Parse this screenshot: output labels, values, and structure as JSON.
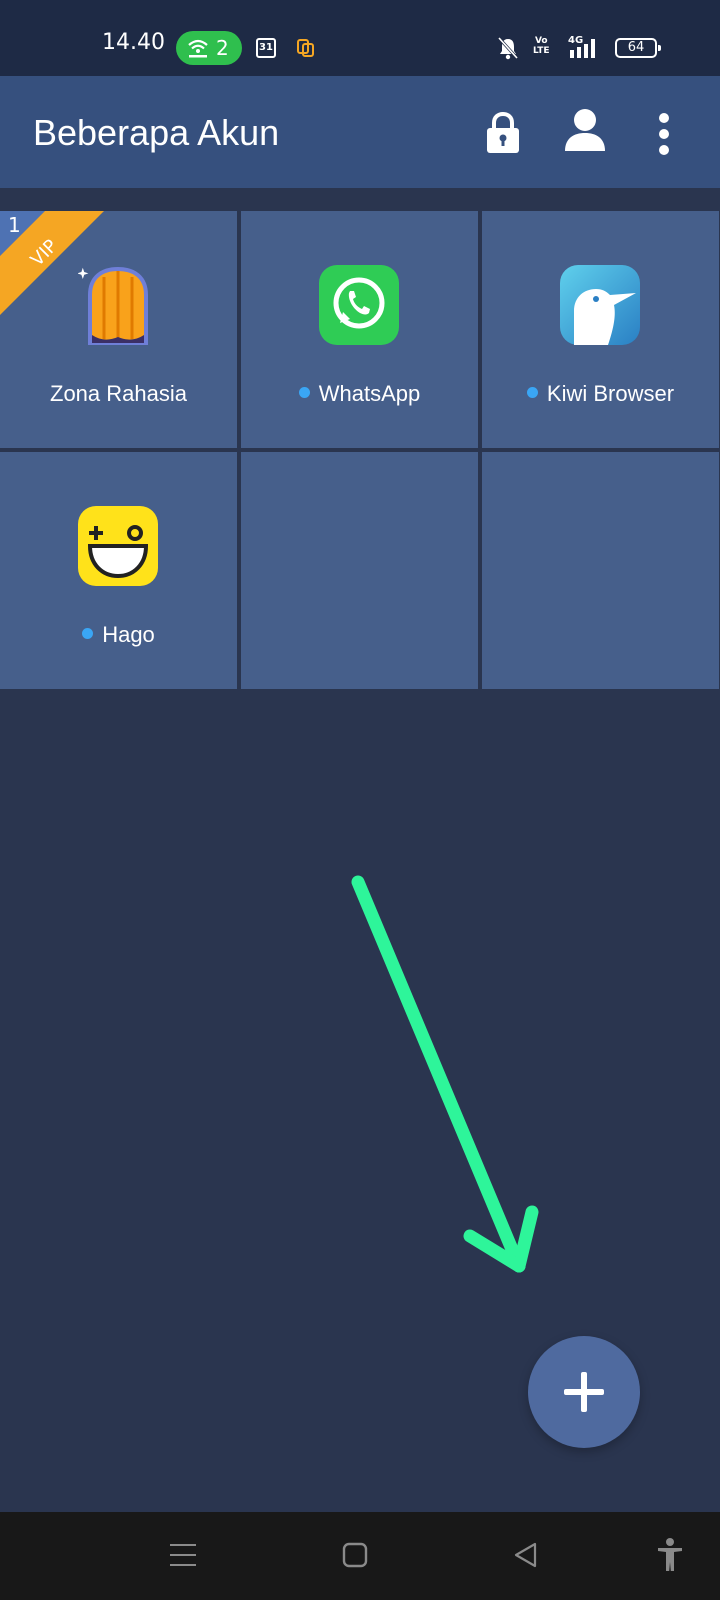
{
  "status_bar": {
    "time": "14.40",
    "hotspot_count": "2",
    "calendar_day": "31",
    "volte_line1": "Vo",
    "volte_line2": "LTE",
    "network": "4G",
    "battery": "64"
  },
  "app_bar": {
    "title": "Beberapa Akun",
    "icons": [
      "lock-icon",
      "account-icon",
      "more-vert-icon"
    ]
  },
  "tiles": [
    {
      "label": "Zona Rahasia",
      "icon": "secret-zone-icon",
      "badge_number": "1",
      "badge_text": "VIP",
      "dot": false
    },
    {
      "label": "WhatsApp",
      "icon": "whatsapp-icon",
      "dot": true
    },
    {
      "label": "Kiwi Browser",
      "icon": "kiwi-browser-icon",
      "dot": true
    },
    {
      "label": "Hago",
      "icon": "hago-icon",
      "dot": true
    },
    {
      "label": "",
      "icon": "",
      "dot": false
    },
    {
      "label": "",
      "icon": "",
      "dot": false
    }
  ],
  "fab": {
    "icon": "plus-icon"
  },
  "colors": {
    "status_bar": "#1e2a45",
    "app_bar": "#36507e",
    "background": "#2a354f",
    "tile": "#465f8b",
    "dot": "#3aa6f5",
    "vip_ribbon": "#f5a623",
    "fab": "#4f6a9f",
    "annotation_arrow": "#2ef59a",
    "nav_bar": "#181818"
  },
  "nav_bar": {
    "items": [
      "menu-icon",
      "home-icon",
      "back-icon",
      "accessibility-icon"
    ]
  }
}
